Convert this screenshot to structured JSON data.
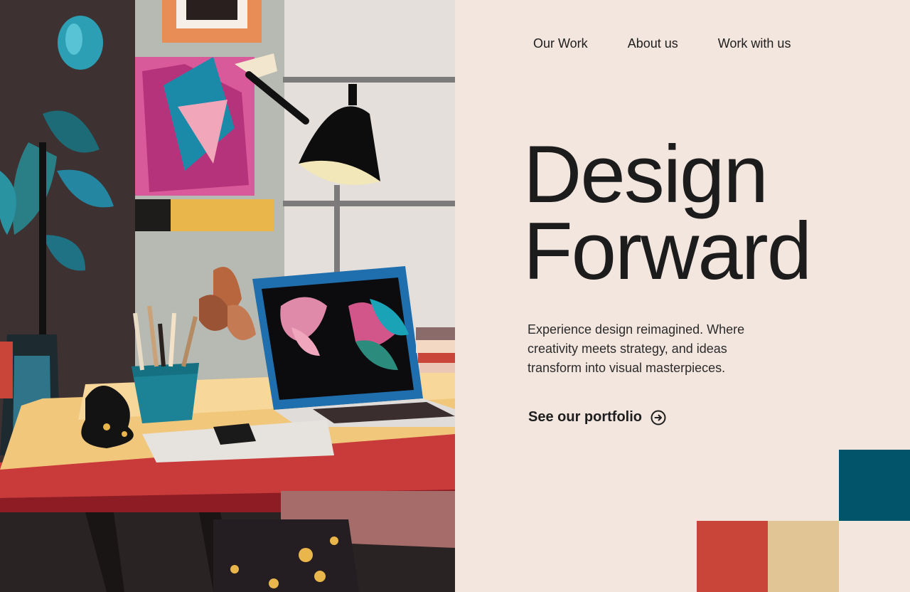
{
  "nav": {
    "items": [
      "Our Work",
      "About us",
      "Work with us"
    ]
  },
  "hero": {
    "headline_line1": "Design",
    "headline_line2": "Forward",
    "tagline": "Experience design reimagined. Where creativity meets strategy, and ideas transform into visual masterpieces.",
    "cta_label": "See our portfolio",
    "cta_icon": "arrow-right-circle-icon"
  },
  "colors": {
    "background": "#f3e6de",
    "teal": "#02546a",
    "red": "#c9453a",
    "sand": "#e2c595",
    "text": "#1e1e1e"
  },
  "illustration": {
    "subject": "desk-workspace-illustration"
  }
}
